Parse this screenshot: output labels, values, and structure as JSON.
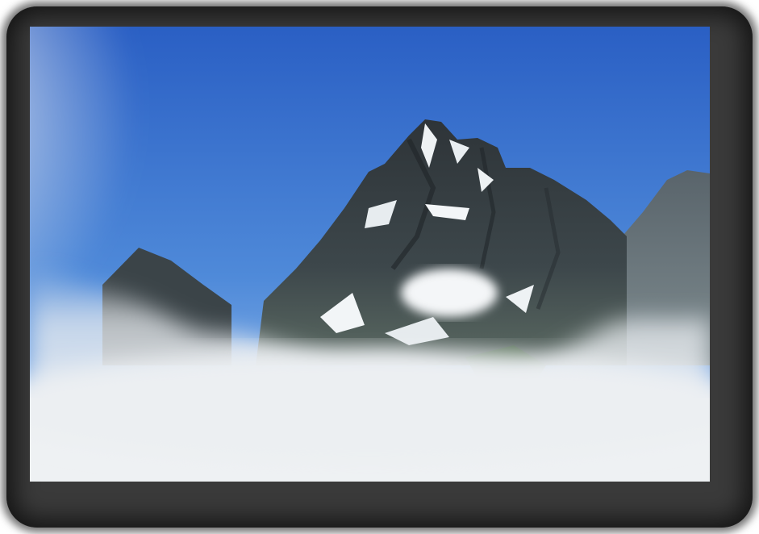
{
  "photo": {
    "subject_icon": "mountain-peak-icon",
    "colors": {
      "sky_top": "#2a5fc4",
      "sky_bottom": "#6ea6e6",
      "rock_dark": "#2b3136",
      "rock_mid": "#4a5559",
      "snow": "#f2f5f7",
      "cloud": "#e9edf0",
      "frame": "#3a3a3a"
    }
  }
}
